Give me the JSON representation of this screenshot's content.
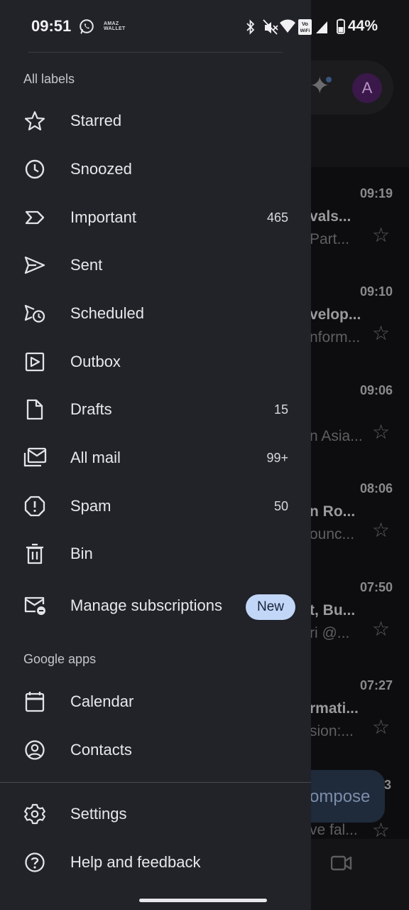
{
  "status_bar": {
    "time": "09:51",
    "battery": "44%",
    "wifi_badge_top": "Vo",
    "wifi_badge_bottom": "WiFi",
    "pay_line1": "AMAZ",
    "pay_line2": "WALLET"
  },
  "drawer": {
    "section_all_labels": "All labels",
    "section_google_apps": "Google apps",
    "items": [
      {
        "label": "Starred",
        "count": "",
        "icon": "star-icon"
      },
      {
        "label": "Snoozed",
        "count": "",
        "icon": "clock-icon"
      },
      {
        "label": "Important",
        "count": "465",
        "icon": "important-icon"
      },
      {
        "label": "Sent",
        "count": "",
        "icon": "send-icon"
      },
      {
        "label": "Scheduled",
        "count": "",
        "icon": "scheduled-send-icon"
      },
      {
        "label": "Outbox",
        "count": "",
        "icon": "outbox-icon"
      },
      {
        "label": "Drafts",
        "count": "15",
        "icon": "draft-icon"
      },
      {
        "label": "All mail",
        "count": "99+",
        "icon": "all-mail-icon"
      },
      {
        "label": "Spam",
        "count": "50",
        "icon": "spam-icon"
      },
      {
        "label": "Bin",
        "count": "",
        "icon": "trash-icon"
      },
      {
        "label": "Manage subscriptions",
        "badge": "New",
        "icon": "manage-subscriptions-icon"
      }
    ],
    "apps": [
      {
        "label": "Calendar",
        "icon": "calendar-icon"
      },
      {
        "label": "Contacts",
        "icon": "contacts-icon"
      }
    ],
    "footer": [
      {
        "label": "Settings",
        "icon": "gear-icon"
      },
      {
        "label": "Help and feedback",
        "icon": "help-icon"
      }
    ]
  },
  "background": {
    "avatar_letter": "A",
    "compose_label": "ompose",
    "emails": [
      {
        "time": "09:19",
        "subject": "vals...",
        "snippet": "Part..."
      },
      {
        "time": "09:10",
        "subject": "velop...",
        "snippet": "nform..."
      },
      {
        "time": "09:06",
        "subject": "",
        "snippet": "n Asia..."
      },
      {
        "time": "08:06",
        "subject": "n Ro...",
        "snippet": "ounc..."
      },
      {
        "time": "07:50",
        "subject": "t, Bu...",
        "snippet": "ri @..."
      },
      {
        "time": "07:27",
        "subject": "rmati...",
        "snippet": "sion:..."
      }
    ],
    "last_time_fragment": "3",
    "last_snippet": "ve fal..."
  },
  "colors": {
    "drawer_bg": "#212329",
    "badge_bg": "#c2d6f7",
    "avatar_bg": "#3a1849"
  }
}
